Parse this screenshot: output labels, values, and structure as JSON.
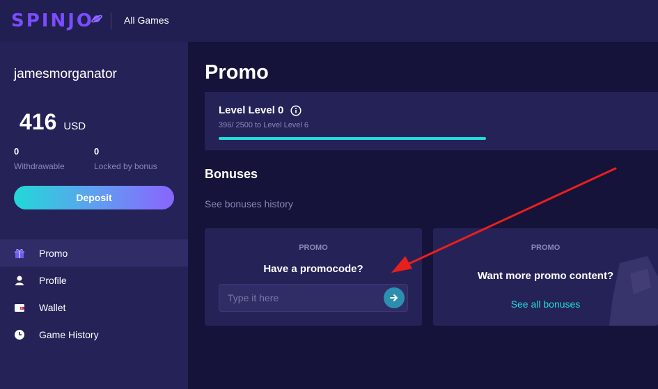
{
  "header": {
    "logo_text": "SPINJO",
    "nav_all_games": "All Games"
  },
  "sidebar": {
    "username": "jamesmorganator",
    "balance_amount": "416",
    "balance_currency": "USD",
    "withdrawable_value": "0",
    "withdrawable_label": "Withdrawable",
    "locked_value": "0",
    "locked_label": "Locked by bonus",
    "deposit_label": "Deposit",
    "menu": [
      {
        "label": "Promo",
        "icon": "gift-icon",
        "active": true
      },
      {
        "label": "Profile",
        "icon": "user-icon",
        "active": false
      },
      {
        "label": "Wallet",
        "icon": "wallet-icon",
        "active": false
      },
      {
        "label": "Game History",
        "icon": "clock-icon",
        "active": false
      }
    ]
  },
  "main": {
    "page_title": "Promo",
    "level": {
      "title": "Level Level 0",
      "subtitle": "396/ 2500 to Level Level 6",
      "progress_fraction": 0.64
    },
    "bonuses_title": "Bonuses",
    "bonuses_history_link": "See bonuses history",
    "promo_card": {
      "eyebrow": "PROMO",
      "title": "Have a promocode?",
      "input_placeholder": "Type it here"
    },
    "content_card": {
      "eyebrow": "PROMO",
      "title": "Want more promo content?",
      "link": "See all bonuses"
    }
  },
  "colors": {
    "accent_cyan": "#23dcdc",
    "accent_purple": "#7a4dff",
    "annotation_arrow": "#e8201c"
  }
}
